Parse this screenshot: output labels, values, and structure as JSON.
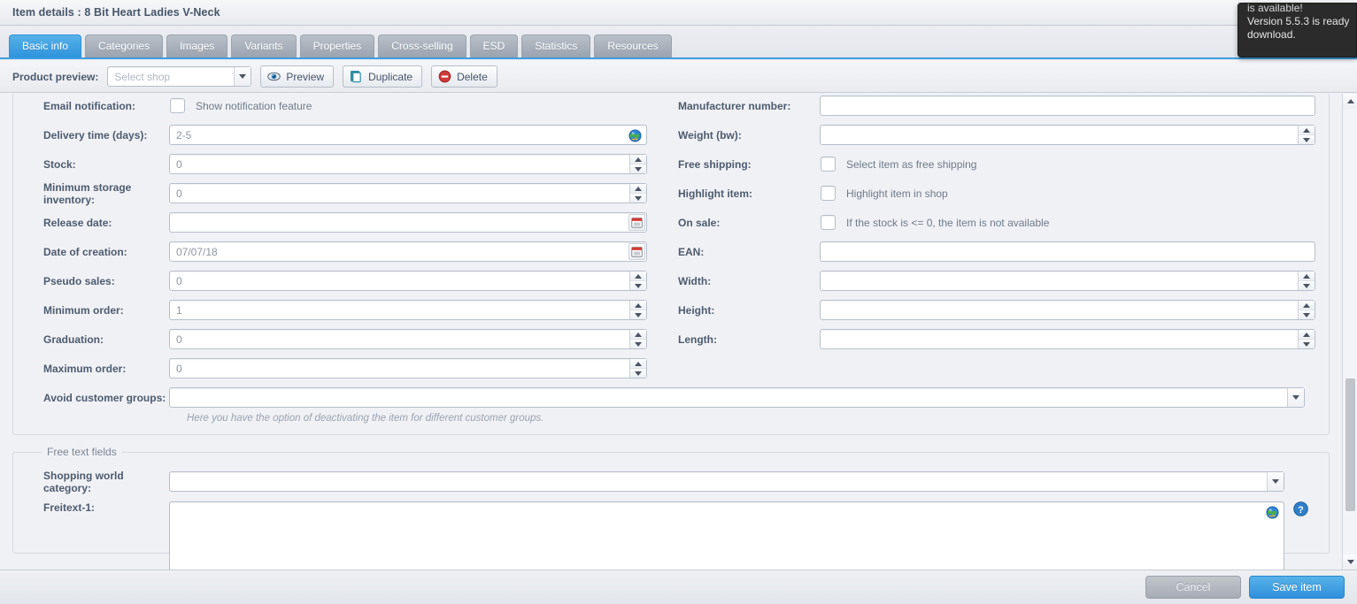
{
  "window": {
    "title": "Item details : 8 Bit Heart Ladies V-Neck"
  },
  "toast": {
    "line1": "is available!",
    "line2": "Version 5.5.3 is ready",
    "line3": "download."
  },
  "tabs": [
    {
      "label": "Basic info",
      "active": true
    },
    {
      "label": "Categories",
      "active": false
    },
    {
      "label": "Images",
      "active": false
    },
    {
      "label": "Variants",
      "active": false
    },
    {
      "label": "Properties",
      "active": false
    },
    {
      "label": "Cross-selling",
      "active": false
    },
    {
      "label": "ESD",
      "active": false
    },
    {
      "label": "Statistics",
      "active": false
    },
    {
      "label": "Resources",
      "active": false
    }
  ],
  "toolbar": {
    "preview_label": "Product preview:",
    "shop_placeholder": "Select shop",
    "shop_value": "",
    "preview_button": "Preview",
    "duplicate_button": "Duplicate",
    "delete_button": "Delete"
  },
  "left_fields": {
    "email_notification_label": "Email notification:",
    "email_notification_checkbox_text": "Show notification feature",
    "email_notification_checked": false,
    "delivery_time_label": "Delivery time (days):",
    "delivery_time_value": "2-5",
    "stock_label": "Stock:",
    "stock_value": "0",
    "min_storage_label": "Minimum storage inventory:",
    "min_storage_value": "0",
    "release_date_label": "Release date:",
    "release_date_value": "",
    "date_creation_label": "Date of creation:",
    "date_creation_value": "07/07/18",
    "pseudo_sales_label": "Pseudo sales:",
    "pseudo_sales_value": "0",
    "minimum_order_label": "Minimum order:",
    "minimum_order_value": "1",
    "graduation_label": "Graduation:",
    "graduation_value": "0",
    "maximum_order_label": "Maximum order:",
    "maximum_order_value": "0",
    "avoid_groups_label": "Avoid customer groups:",
    "avoid_groups_value": "",
    "avoid_groups_hint": "Here you have the option of deactivating the item for different customer groups."
  },
  "right_fields": {
    "manufacturer_number_label": "Manufacturer number:",
    "manufacturer_number_value": "",
    "weight_label": "Weight (bw):",
    "weight_value": "",
    "free_shipping_label": "Free shipping:",
    "free_shipping_checkbox_text": "Select item as free shipping",
    "free_shipping_checked": false,
    "highlight_label": "Highlight item:",
    "highlight_checkbox_text": "Highlight item in shop",
    "highlight_checked": false,
    "on_sale_label": "On sale:",
    "on_sale_checkbox_text": "If the stock is <= 0, the item is not available",
    "on_sale_checked": false,
    "ean_label": "EAN:",
    "ean_value": "",
    "width_label": "Width:",
    "width_value": "",
    "height_label": "Height:",
    "height_value": "",
    "length_label": "Length:",
    "length_value": ""
  },
  "free_text": {
    "legend": "Free text fields",
    "shopping_world_label": "Shopping world category:",
    "shopping_world_value": "",
    "freitext1_label": "Freitext-1:",
    "freitext1_value": ""
  },
  "footer": {
    "cancel_label": "Cancel",
    "save_label": "Save item"
  },
  "colors": {
    "accent": "#3c9ee0",
    "save_button": "#2f8fdc",
    "delete_icon": "#cf3b3b",
    "duplicate_icon": "#2e8fa3",
    "help_icon": "#2f80c8",
    "toast_bg": "#2b2b2b"
  }
}
